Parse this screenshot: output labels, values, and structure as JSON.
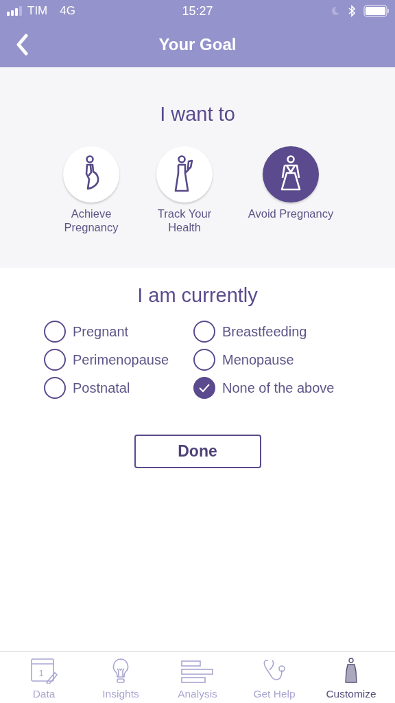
{
  "status_bar": {
    "carrier": "TIM",
    "network": "4G",
    "time": "15:27"
  },
  "nav": {
    "title": "Your Goal"
  },
  "goal": {
    "heading": "I want to",
    "options": [
      {
        "kind": "pregnant",
        "label": "Achieve Pregnancy",
        "selected": false
      },
      {
        "kind": "phone",
        "label": "Track Your Health",
        "selected": false
      },
      {
        "kind": "dress",
        "label": "Avoid Pregnancy",
        "selected": true
      }
    ]
  },
  "status": {
    "heading": "I am currently",
    "options": [
      {
        "label": "Pregnant",
        "checked": false
      },
      {
        "label": "Breastfeeding",
        "checked": false
      },
      {
        "label": "Perimenopause",
        "checked": false
      },
      {
        "label": "Menopause",
        "checked": false
      },
      {
        "label": "Postnatal",
        "checked": false
      },
      {
        "label": "None of the above",
        "checked": true
      }
    ]
  },
  "done_button": "Done",
  "tab_bar": [
    {
      "kind": "calendar",
      "label": "Data",
      "day": "1",
      "selected": false
    },
    {
      "kind": "bulb",
      "label": "Insights",
      "selected": false
    },
    {
      "kind": "bars",
      "label": "Analysis",
      "selected": false
    },
    {
      "kind": "stethoscope",
      "label": "Get Help",
      "selected": false
    },
    {
      "kind": "dress",
      "label": "Customize",
      "selected": true
    }
  ]
}
